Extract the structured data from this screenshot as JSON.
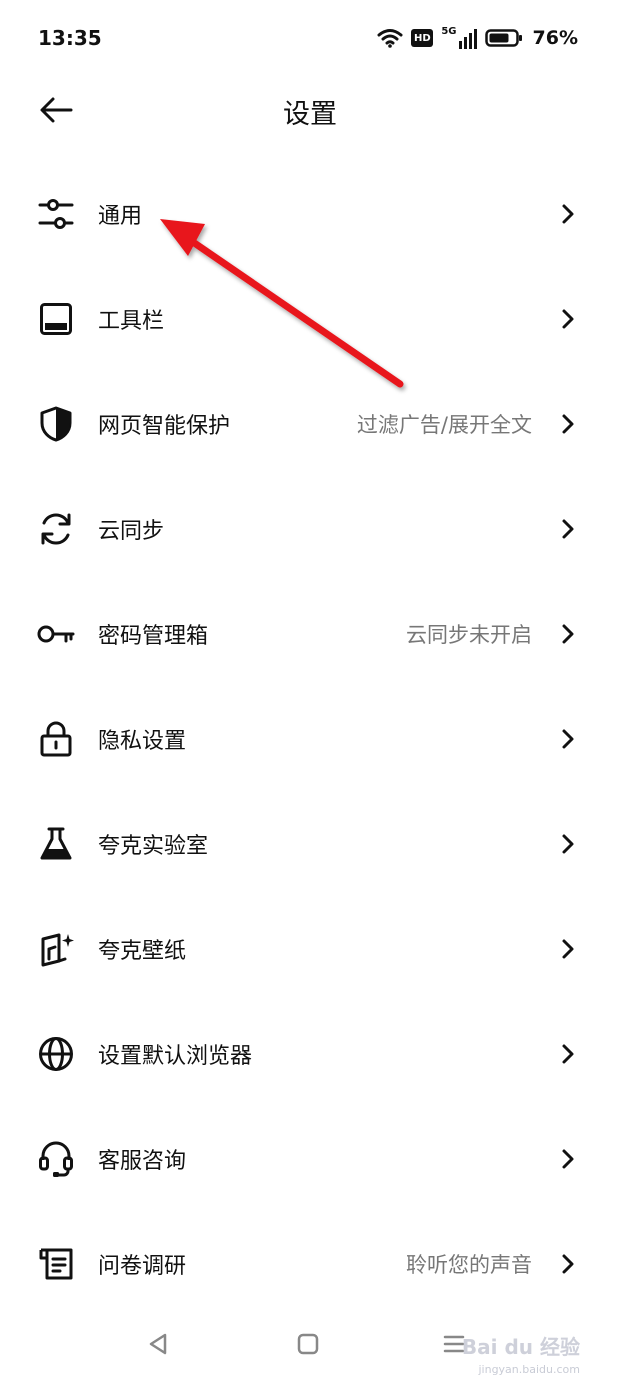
{
  "status_bar": {
    "time": "13:35",
    "hd_badge": "HD",
    "network": "5G",
    "battery": "76%"
  },
  "header": {
    "title": "设置"
  },
  "menu": {
    "items": [
      {
        "label": "通用",
        "value": "",
        "icon": "sliders-icon"
      },
      {
        "label": "工具栏",
        "value": "",
        "icon": "toolbar-icon"
      },
      {
        "label": "网页智能保护",
        "value": "过滤广告/展开全文",
        "icon": "shield-icon"
      },
      {
        "label": "云同步",
        "value": "",
        "icon": "sync-icon"
      },
      {
        "label": "密码管理箱",
        "value": "云同步未开启",
        "icon": "key-icon"
      },
      {
        "label": "隐私设置",
        "value": "",
        "icon": "lock-icon"
      },
      {
        "label": "夸克实验室",
        "value": "",
        "icon": "flask-icon"
      },
      {
        "label": "夸克壁纸",
        "value": "",
        "icon": "wallpaper-icon"
      },
      {
        "label": "设置默认浏览器",
        "value": "",
        "icon": "globe-icon"
      },
      {
        "label": "客服咨询",
        "value": "",
        "icon": "headset-icon"
      },
      {
        "label": "问卷调研",
        "value": "聆听您的声音",
        "icon": "survey-icon"
      }
    ]
  },
  "watermark": {
    "brand": "Bai du 经验",
    "url": "jingyan.baidu.com"
  },
  "colors": {
    "annotation_arrow": "#e8141c",
    "value_text": "#777777"
  }
}
